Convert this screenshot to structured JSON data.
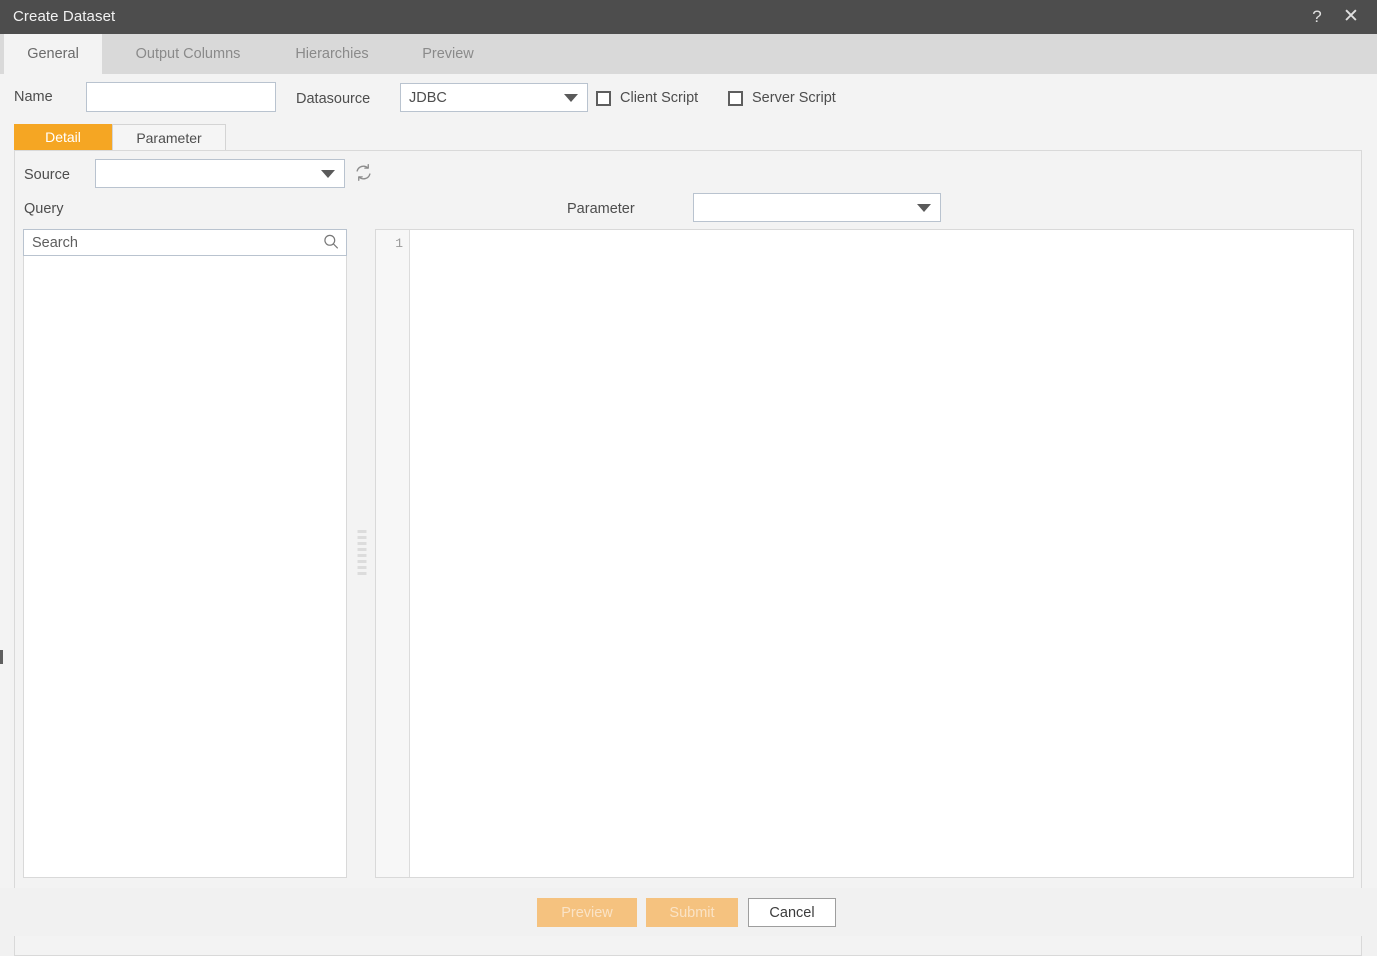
{
  "window": {
    "title": "Create Dataset",
    "help_icon": "question-mark-icon",
    "close_icon": "close-icon"
  },
  "tabs": [
    {
      "label": "General",
      "active": true
    },
    {
      "label": "Output Columns",
      "active": false
    },
    {
      "label": "Hierarchies",
      "active": false
    },
    {
      "label": "Preview",
      "active": false
    }
  ],
  "general": {
    "name_label": "Name",
    "name_value": "",
    "name_placeholder": "",
    "datasource_label": "Datasource",
    "datasource_value": "JDBC",
    "datasource_options": [
      "JDBC"
    ],
    "client_script": {
      "label": "Client Script",
      "checked": false
    },
    "server_script": {
      "label": "Server Script",
      "checked": false
    }
  },
  "inner_tabs": [
    {
      "label": "Detail",
      "active": true
    },
    {
      "label": "Parameter",
      "active": false
    }
  ],
  "detail": {
    "source_label": "Source",
    "source_value": "",
    "source_options": [],
    "refresh_icon": "refresh-icon",
    "query_label": "Query",
    "parameter_label": "Parameter",
    "parameter_value": "",
    "parameter_options": [],
    "search_placeholder": "Search",
    "search_value": "",
    "search_icon": "search-icon",
    "editor_line_number": "1",
    "editor_content": ""
  },
  "footer": {
    "preview_label": "Preview",
    "preview_enabled": false,
    "submit_label": "Submit",
    "submit_enabled": false,
    "cancel_label": "Cancel",
    "cancel_enabled": true
  },
  "colors": {
    "titlebar": "#4d4d4d",
    "accent_orange": "#f5a623",
    "disabled_button": "#f5c27f",
    "panel_bg": "#f3f3f3",
    "tabstrip_bg": "#d9d9d9"
  }
}
